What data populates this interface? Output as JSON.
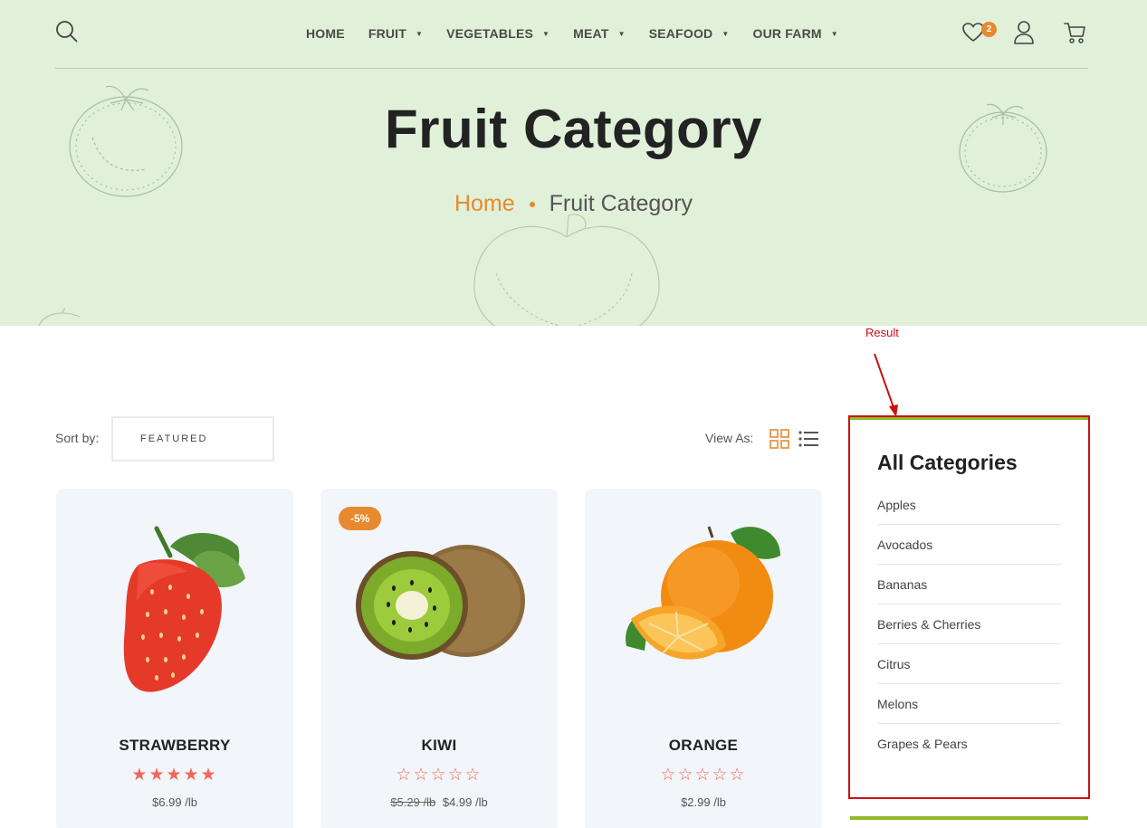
{
  "header": {
    "nav": [
      {
        "label": "HOME",
        "has_dropdown": false
      },
      {
        "label": "FRUIT",
        "has_dropdown": true
      },
      {
        "label": "VEGETABLES",
        "has_dropdown": true
      },
      {
        "label": "MEAT",
        "has_dropdown": true
      },
      {
        "label": "SEAFOOD",
        "has_dropdown": true
      },
      {
        "label": "OUR FARM",
        "has_dropdown": true
      }
    ],
    "wishlist_count": "2",
    "icons": [
      "search-icon",
      "heart-icon",
      "user-icon",
      "cart-icon"
    ]
  },
  "hero": {
    "title": "Fruit Category",
    "breadcrumb": {
      "home": "Home",
      "current": "Fruit Category"
    }
  },
  "toolbar": {
    "sort_label": "Sort by:",
    "sort_value": "FEATURED",
    "view_label": "View As:"
  },
  "products": [
    {
      "name": "STRAWBERRY",
      "stars": "★★★★★",
      "rating": 5,
      "price": "$6.99 /lb",
      "old_price": "",
      "badge": ""
    },
    {
      "name": "KIWI",
      "stars": "☆☆☆☆☆",
      "rating": 0,
      "price": "$4.99 /lb",
      "old_price": "$5.29 /lb",
      "badge": "-5%"
    },
    {
      "name": "ORANGE",
      "stars": "☆☆☆☆☆",
      "rating": 0,
      "price": "$2.99 /lb",
      "old_price": "",
      "badge": ""
    }
  ],
  "sidebar": {
    "annotation": "Result",
    "title": "All Categories",
    "categories": [
      "Apples",
      "Avocados",
      "Bananas",
      "Berries & Cherries",
      "Citrus",
      "Melons",
      "Grapes & Pears"
    ]
  },
  "colors": {
    "hero_bg": "#e0f0d9",
    "accent_orange": "#e8892f",
    "star_red": "#f2665a",
    "card_bg": "#f2f5f9",
    "sidebar_green": "#93b82a",
    "annotation_red": "#cc1111"
  }
}
